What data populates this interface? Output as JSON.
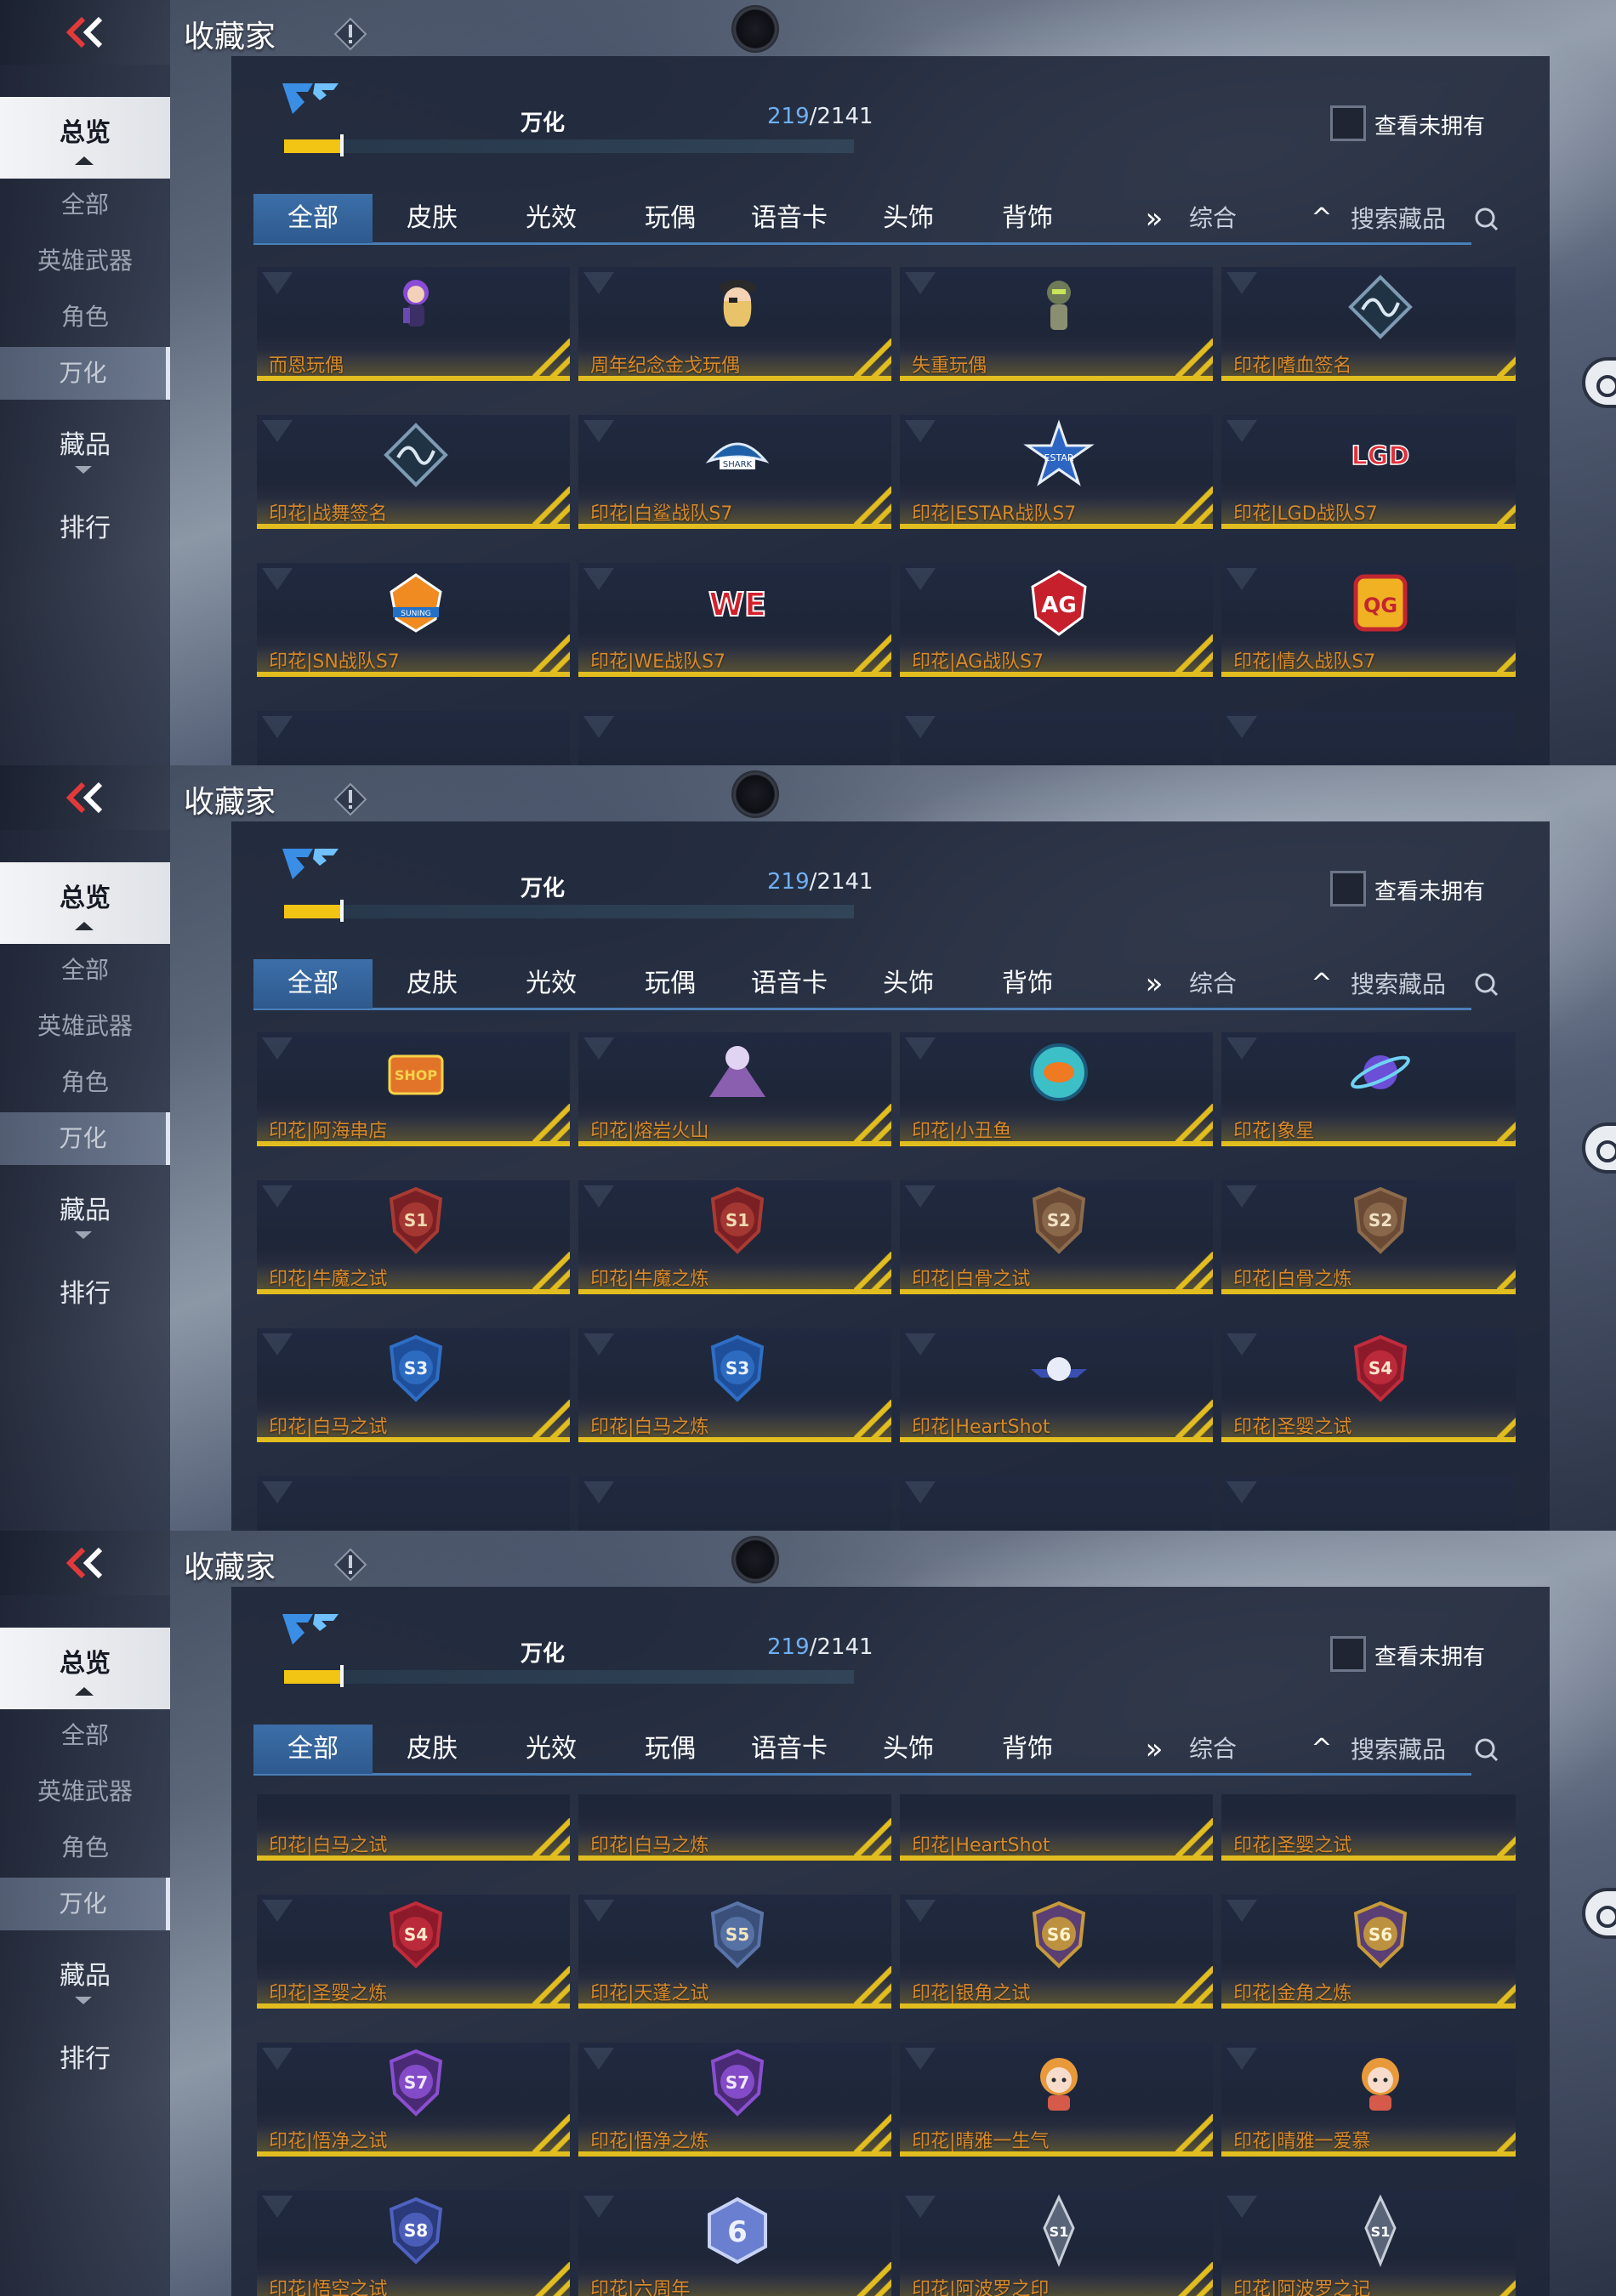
{
  "header": {
    "title": "收藏家"
  },
  "sidebar": {
    "overview": "总览",
    "subitems": [
      "全部",
      "英雄武器",
      "角色",
      "万化"
    ],
    "active_sub": 3,
    "collectibles": "藏品",
    "ranking": "排行"
  },
  "progress": {
    "name": "万化",
    "owned": "219",
    "total": "/2141",
    "fraction": 0.102
  },
  "filter": {
    "show_unowned_label": "查看未拥有"
  },
  "tabs": [
    "全部",
    "皮肤",
    "光效",
    "玩偶",
    "语音卡",
    "头饰",
    "背饰"
  ],
  "active_tab": 0,
  "more_tabs_icon": "»",
  "sort": {
    "label": "综合"
  },
  "search": {
    "placeholder": "搜索藏品"
  },
  "colors": {
    "accent_blue": "#3c6ea8",
    "gold": "#e2bd1f",
    "item_name": "#d8892a",
    "owned_count": "#6fb0f5"
  },
  "panels": [
    {
      "items": [
        {
          "name": "而恩玩偶",
          "icon": "doll-purple"
        },
        {
          "name": "周年纪念金戈玩偶",
          "icon": "doll-captain"
        },
        {
          "name": "失重玩偶",
          "icon": "doll-robot"
        },
        {
          "name": "印花|嗜血签名",
          "icon": "sticker-signature"
        },
        {
          "name": "印花|战舞签名",
          "icon": "sticker-signature-2"
        },
        {
          "name": "印花|白鲨战队S7",
          "icon": "team-shark"
        },
        {
          "name": "印花|ESTAR战队S7",
          "icon": "team-estar"
        },
        {
          "name": "印花|LGD战队S7",
          "icon": "team-lgd"
        },
        {
          "name": "印花|SN战队S7",
          "icon": "team-suning"
        },
        {
          "name": "印花|WE战队S7",
          "icon": "team-we"
        },
        {
          "name": "印花|AG战队S7",
          "icon": "team-ag"
        },
        {
          "name": "印花|情久战队S7",
          "icon": "team-qg"
        },
        {
          "name": "",
          "icon": "partial-1"
        },
        {
          "name": "",
          "icon": "partial-2"
        },
        {
          "name": "",
          "icon": "partial-3"
        },
        {
          "name": "",
          "icon": "partial-4"
        }
      ]
    },
    {
      "items": [
        {
          "name": "印花|阿海串店",
          "icon": "sticker-shop"
        },
        {
          "name": "印花|熔岩火山",
          "icon": "sticker-volcano"
        },
        {
          "name": "印花|小丑鱼",
          "icon": "sticker-fish"
        },
        {
          "name": "印花|象星",
          "icon": "sticker-planet"
        },
        {
          "name": "印花|牛魔之试",
          "icon": "badge-s1"
        },
        {
          "name": "印花|牛魔之炼",
          "icon": "badge-s1"
        },
        {
          "name": "印花|白骨之试",
          "icon": "badge-s2"
        },
        {
          "name": "印花|白骨之炼",
          "icon": "badge-s2"
        },
        {
          "name": "印花|白马之试",
          "icon": "badge-s3"
        },
        {
          "name": "印花|白马之炼",
          "icon": "badge-s3"
        },
        {
          "name": "印花|HeartShot",
          "icon": "sticker-heartshot"
        },
        {
          "name": "印花|圣婴之试",
          "icon": "badge-s4"
        },
        {
          "name": "",
          "icon": "partial-s4"
        },
        {
          "name": "",
          "icon": "partial-s5"
        },
        {
          "name": "",
          "icon": "partial-crown"
        },
        {
          "name": "",
          "icon": "partial-crown"
        }
      ]
    },
    {
      "items": [
        {
          "name": "印花|白马之试",
          "icon": "partial-top"
        },
        {
          "name": "印花|白马之炼",
          "icon": "partial-top"
        },
        {
          "name": "印花|HeartShot",
          "icon": "partial-top"
        },
        {
          "name": "印花|圣婴之试",
          "icon": "partial-top"
        },
        {
          "name": "印花|圣婴之炼",
          "icon": "badge-s4"
        },
        {
          "name": "印花|天蓬之试",
          "icon": "badge-s5"
        },
        {
          "name": "印花|银角之试",
          "icon": "badge-s6"
        },
        {
          "name": "印花|金角之炼",
          "icon": "badge-s6"
        },
        {
          "name": "印花|悟净之试",
          "icon": "badge-s7"
        },
        {
          "name": "印花|悟净之炼",
          "icon": "badge-s7"
        },
        {
          "name": "印花|晴雅一生气",
          "icon": "sticker-girl"
        },
        {
          "name": "印花|晴雅一爱慕",
          "icon": "sticker-girl-2"
        },
        {
          "name": "印花|悟空之试",
          "icon": "badge-s8"
        },
        {
          "name": "印花|六周年",
          "icon": "badge-six"
        },
        {
          "name": "印花|阿波罗之印",
          "icon": "badge-apollo"
        },
        {
          "name": "印花|阿波罗之记",
          "icon": "badge-apollo"
        }
      ]
    }
  ]
}
